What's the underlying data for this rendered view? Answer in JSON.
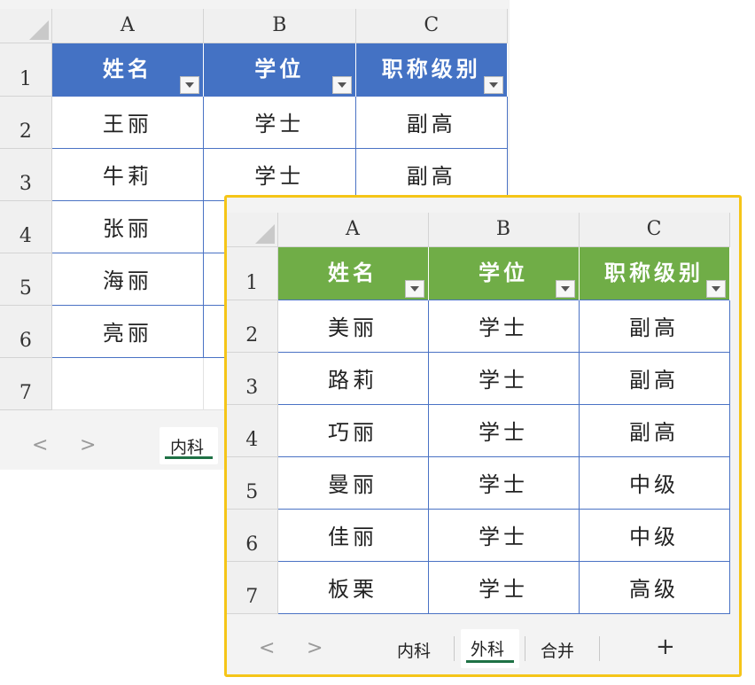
{
  "columns": [
    "A",
    "B",
    "C"
  ],
  "back": {
    "rows": [
      "1",
      "2",
      "3",
      "4",
      "5",
      "6",
      "7"
    ],
    "headers": [
      "姓名",
      "学位",
      "职称级别"
    ],
    "data": [
      [
        "王丽",
        "学士",
        "副高"
      ],
      [
        "牛莉",
        "学士",
        "副高"
      ],
      [
        "张丽",
        "",
        ""
      ],
      [
        "海丽",
        "",
        ""
      ],
      [
        "亮丽",
        "",
        ""
      ]
    ],
    "tabs": [
      "内科"
    ],
    "nav": {
      "prev": "<",
      "next": ">"
    }
  },
  "front": {
    "rows": [
      "1",
      "2",
      "3",
      "4",
      "5",
      "6",
      "7"
    ],
    "headers": [
      "姓名",
      "学位",
      "职称级别"
    ],
    "data": [
      [
        "美丽",
        "学士",
        "副高"
      ],
      [
        "路莉",
        "学士",
        "副高"
      ],
      [
        "巧丽",
        "学士",
        "副高"
      ],
      [
        "曼丽",
        "学士",
        "中级"
      ],
      [
        "佳丽",
        "学士",
        "中级"
      ],
      [
        "板栗",
        "学士",
        "高级"
      ]
    ],
    "tabs": [
      "内科",
      "外科",
      "合并"
    ],
    "active_tab": "外科",
    "add_sheet": "+",
    "nav": {
      "prev": "<",
      "next": ">"
    }
  },
  "colors": {
    "back_header": "#4472c4",
    "front_header": "#70ad47",
    "highlight_border": "#f5c518",
    "active_tab_underline": "#1e7145"
  }
}
